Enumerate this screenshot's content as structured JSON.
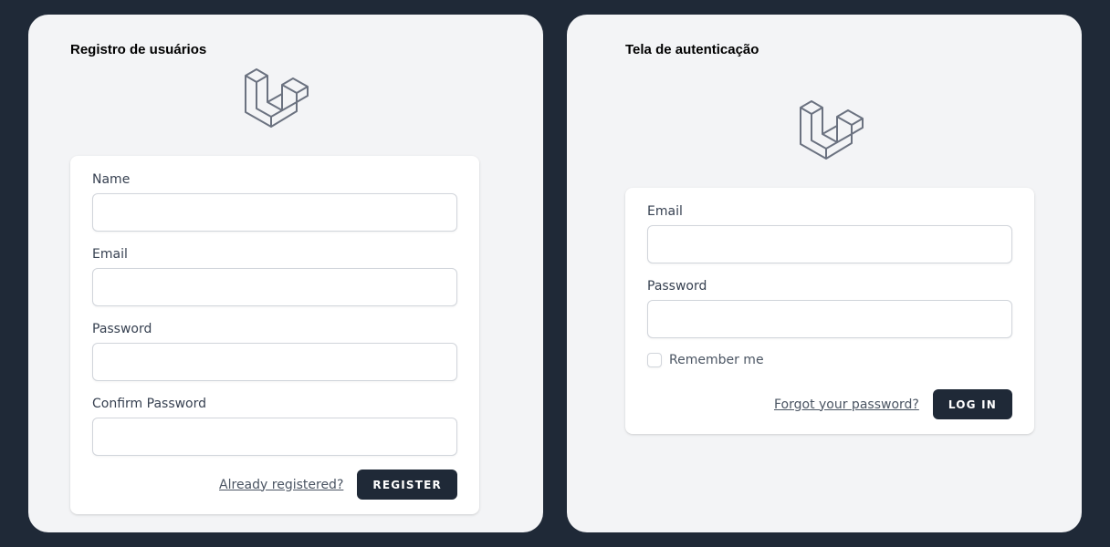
{
  "register": {
    "title": "Registro de usuários",
    "name_label": "Name",
    "email_label": "Email",
    "password_label": "Password",
    "confirm_label": "Confirm Password",
    "name_value": "",
    "email_value": "",
    "password_value": "",
    "confirm_value": "",
    "already_registered": "Already registered?",
    "register_button": "REGISTER"
  },
  "login": {
    "title": "Tela de autenticação",
    "email_label": "Email",
    "password_label": "Password",
    "email_value": "",
    "password_value": "",
    "remember_label": "Remember me",
    "remember_checked": false,
    "forgot_link": "Forgot your password?",
    "login_button": "LOG IN"
  },
  "icons": {
    "logo": "laravel-logo-icon"
  },
  "colors": {
    "page_bg": "#1f2937",
    "panel_bg": "#f3f4f6",
    "card_bg": "#ffffff",
    "button_bg": "#1f2937",
    "logo_stroke": "#6b7280"
  }
}
